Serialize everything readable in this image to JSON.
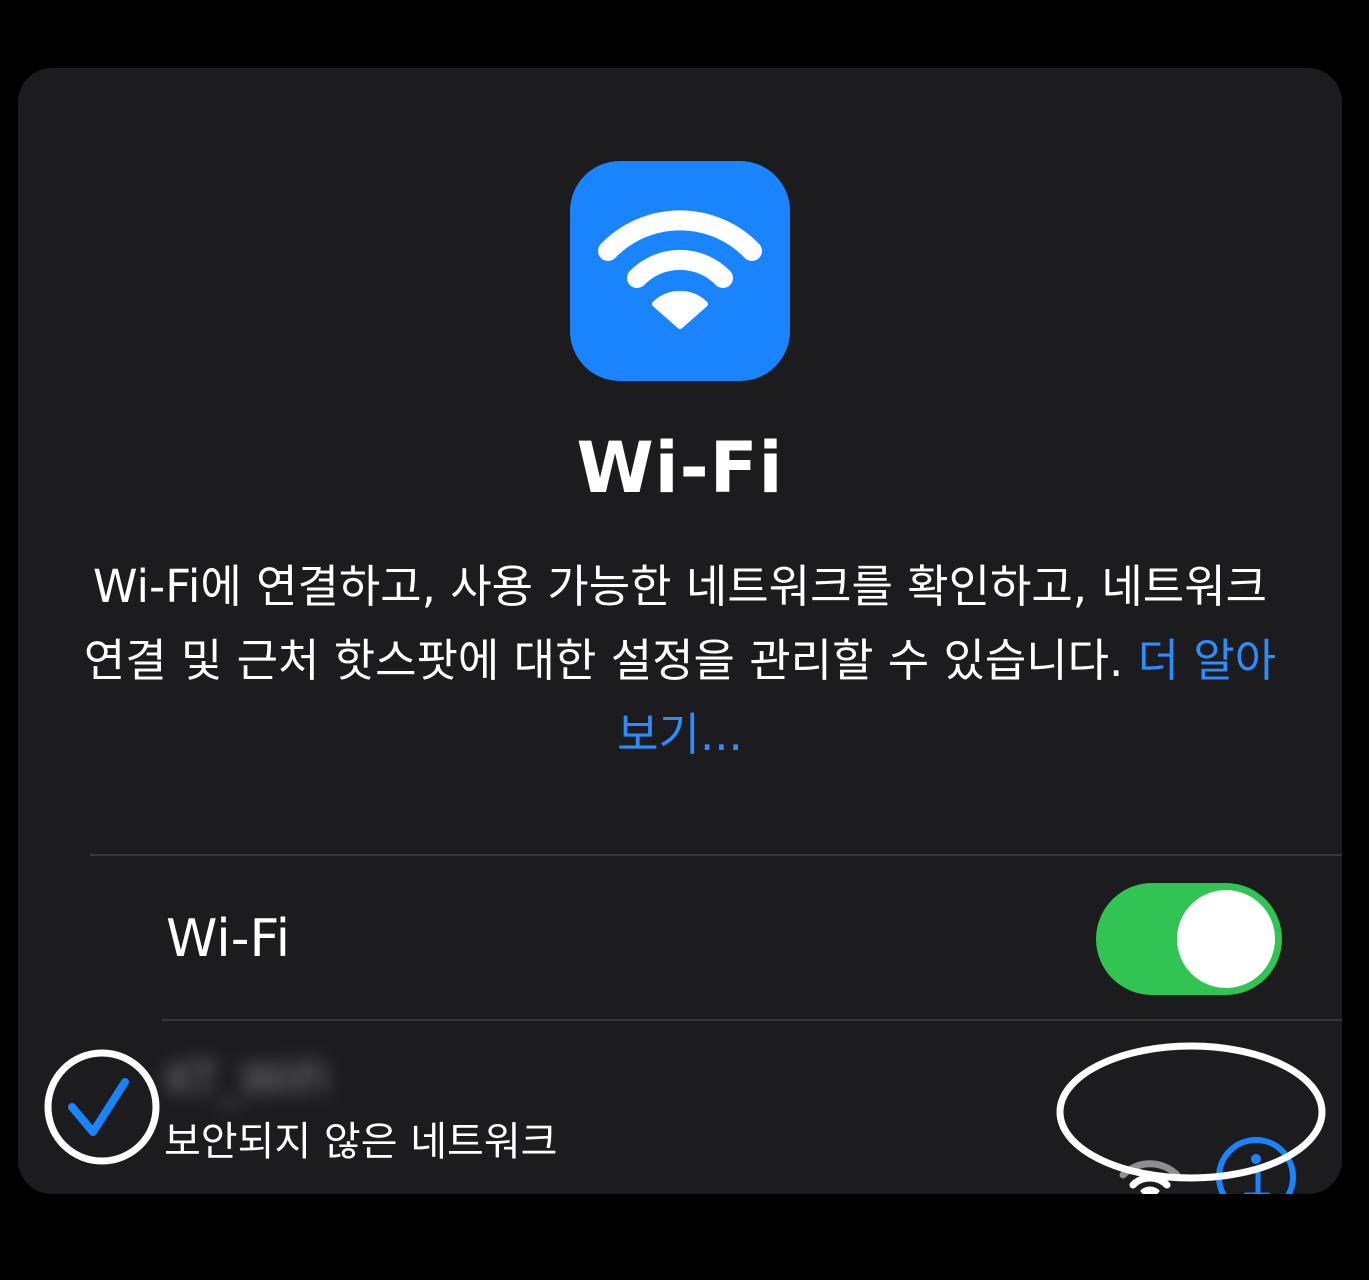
{
  "header": {
    "title": "Wi-Fi",
    "description": "Wi-Fi에 연결하고, 사용 가능한 네트워크를 확인하고, 네트워크 연결 및 근처 핫스팟에 대한 설정을 관리할 수 있습니다.",
    "learn_more_link": "더 알아보기..."
  },
  "wifi_row": {
    "label": "Wi-Fi",
    "toggle_on": true
  },
  "network": {
    "name": "KT_WiFi",
    "subtitle": "보안되지 않은 네트워크",
    "connected": true
  },
  "colors": {
    "accent": "#1a84ff",
    "toggle_on": "#31c452",
    "background": "#1c1c1e",
    "link": "#2d8cff"
  },
  "icons": {
    "app": "wifi-icon",
    "signal": "wifi-signal-icon",
    "info": "info-icon",
    "check": "checkmark-icon"
  }
}
